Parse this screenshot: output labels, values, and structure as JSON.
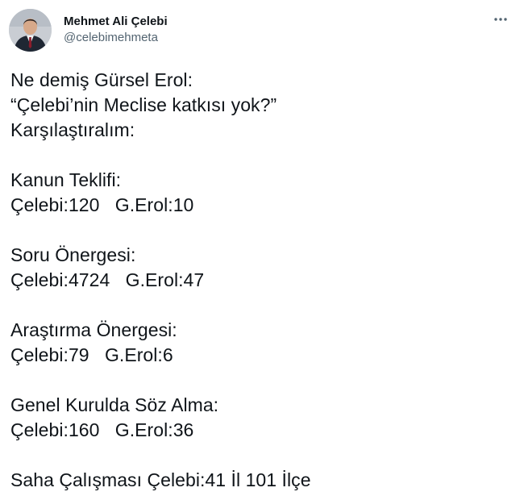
{
  "author": {
    "display_name": "Mehmet Ali Çelebi",
    "handle": "@celebimehmeta",
    "avatar_icon": "avatar-photo"
  },
  "menu": {
    "icon": "more-horizontal-icon"
  },
  "tweet": {
    "lines": [
      "Ne demiş Gürsel Erol:",
      "“Çelebi’nin Meclise katkısı yok?”",
      "Karşılaştıralım:",
      "",
      "Kanun Teklifi:",
      "Çelebi:120   G.Erol:10",
      "",
      "Soru Önergesi:",
      "Çelebi:4724   G.Erol:47",
      "",
      "Araştırma Önergesi:",
      "Çelebi:79   G.Erol:6",
      "",
      "Genel Kurulda Söz Alma:",
      "Çelebi:160   G.Erol:36",
      "",
      "Saha Çalışması Çelebi:41 İl 101 İlçe"
    ]
  },
  "colors": {
    "text_primary": "#0f1419",
    "text_secondary": "#536471",
    "background": "#ffffff"
  }
}
